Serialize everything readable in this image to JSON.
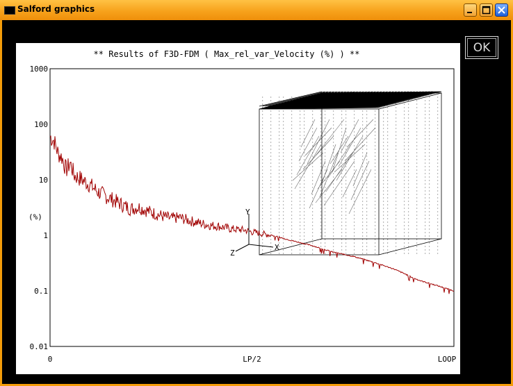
{
  "window": {
    "title": "Salford graphics",
    "ok_label": "OK"
  },
  "chart_data": {
    "type": "line",
    "title": "** Results of F3D-FDM ( Max_rel_var_Velocity (%) ) **",
    "ylabel": "(%)",
    "yscale": "log",
    "ylim": [
      0.01,
      1000
    ],
    "yticks": [
      "1000",
      "100",
      "10",
      "1",
      "0.1",
      "0.01"
    ],
    "xticks": [
      "0",
      "LP/2",
      "LOOP"
    ],
    "xlim": [
      0,
      1
    ],
    "grid": false,
    "series": [
      {
        "color": "#a00000",
        "x": [
          0,
          0.01,
          0.02,
          0.03,
          0.04,
          0.05,
          0.06,
          0.08,
          0.1,
          0.12,
          0.14,
          0.16,
          0.18,
          0.2,
          0.22,
          0.25,
          0.28,
          0.3,
          0.32,
          0.35,
          0.38,
          0.4,
          0.42,
          0.45,
          0.48,
          0.5,
          0.55,
          0.6,
          0.65,
          0.7,
          0.75,
          0.8,
          0.85,
          0.88,
          0.9,
          0.92,
          0.95,
          1.0
        ],
        "y": [
          60,
          50,
          30,
          25,
          15,
          20,
          12,
          10,
          8,
          6,
          5,
          4.2,
          3.5,
          3,
          3.2,
          2.6,
          2.2,
          2,
          2.1,
          1.8,
          1.6,
          1.5,
          1.45,
          1.3,
          1.25,
          1.15,
          1.0,
          0.8,
          0.65,
          0.5,
          0.42,
          0.33,
          0.25,
          0.2,
          0.17,
          0.15,
          0.13,
          0.1
        ]
      }
    ],
    "axis_triad": {
      "x": "X",
      "y": "Y",
      "z": "Z"
    }
  }
}
